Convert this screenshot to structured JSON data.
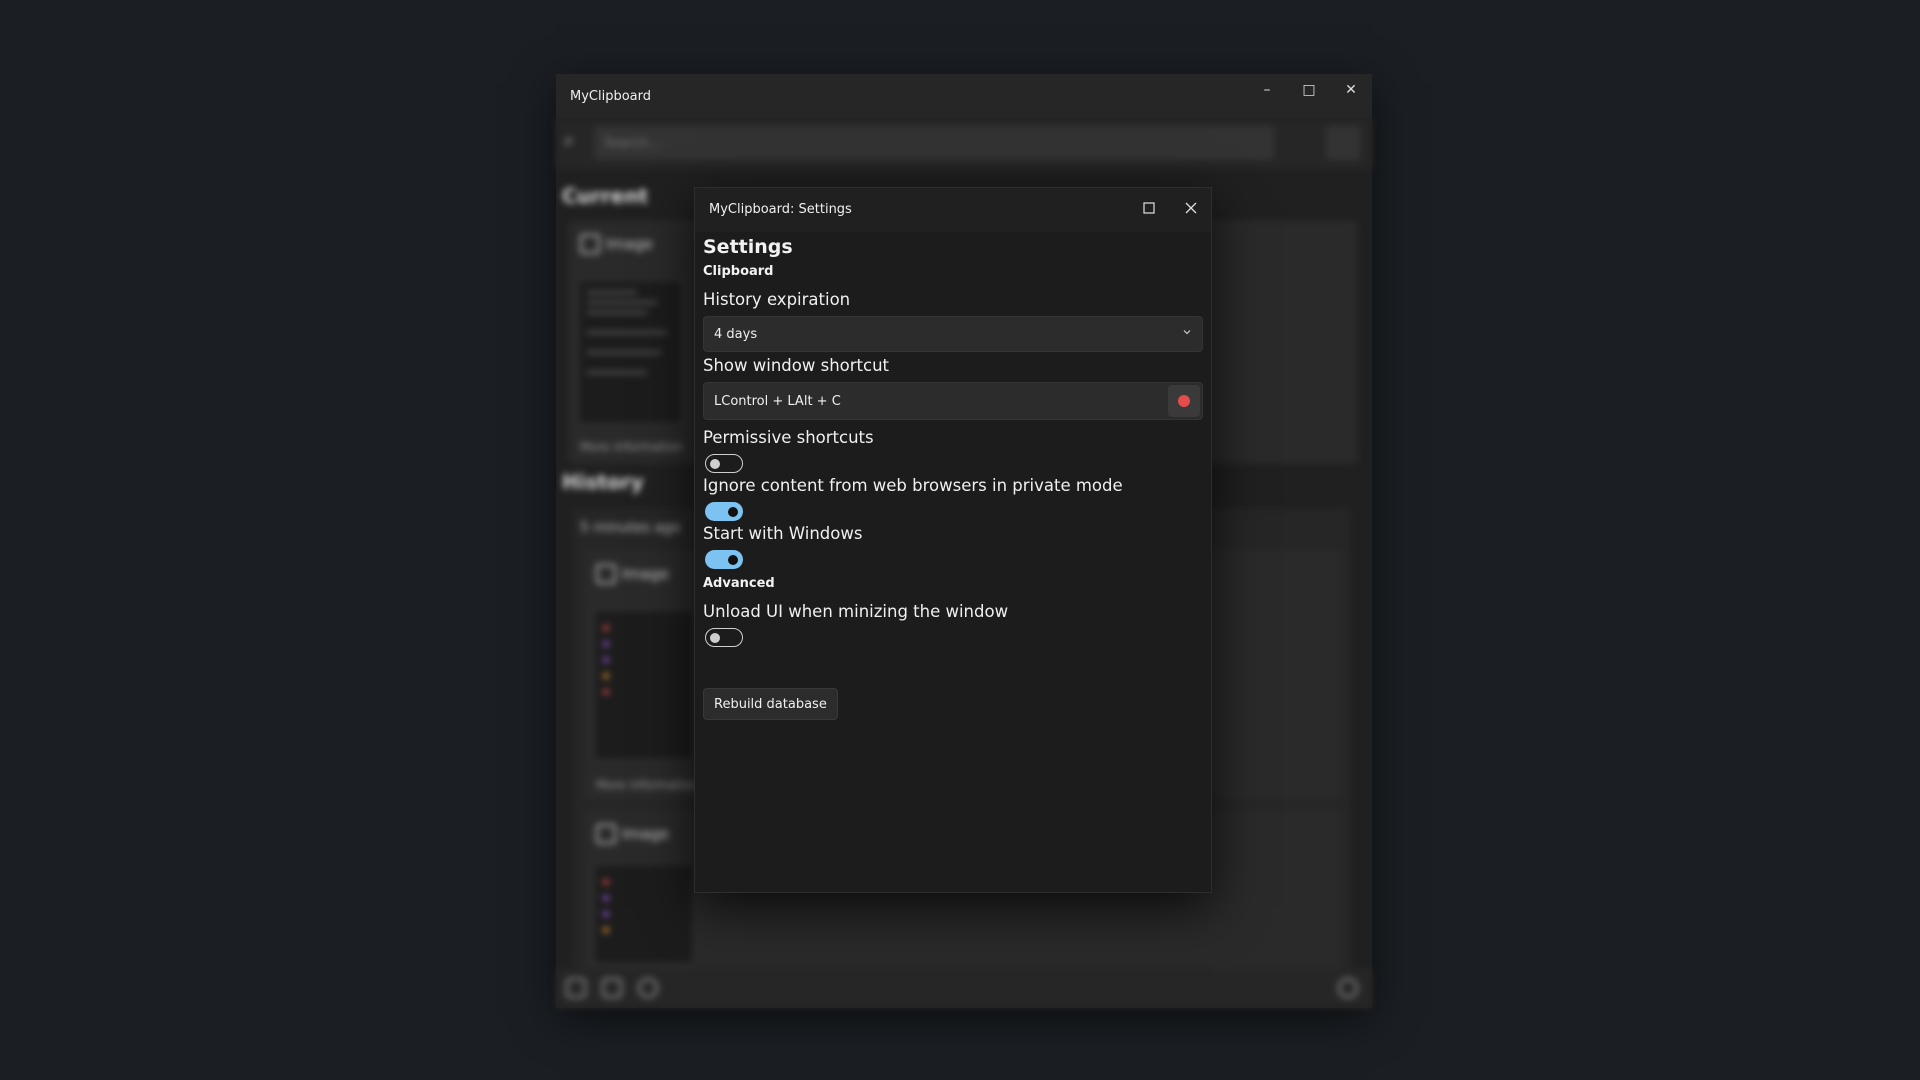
{
  "main_window": {
    "title": "MyClipboard",
    "search_placeholder": "Search...",
    "current_label": "Current",
    "history_label": "History",
    "card_type_label": "Image",
    "more_info_label": "More information",
    "group_time_label": "5 minutes ago"
  },
  "settings_window": {
    "title": "MyClipboard: Settings",
    "heading": "Settings",
    "clipboard_group": "Clipboard",
    "history_expiration": {
      "label": "History expiration",
      "selected": "4 days"
    },
    "show_window_shortcut": {
      "label": "Show window shortcut",
      "value": "LControl + LAlt + C"
    },
    "permissive_shortcuts": {
      "label": "Permissive shortcuts",
      "enabled": false
    },
    "ignore_private": {
      "label": "Ignore content from web browsers in private mode",
      "enabled": true
    },
    "start_with_windows": {
      "label": "Start with Windows",
      "enabled": true
    },
    "advanced_group": "Advanced",
    "unload_ui": {
      "label": "Unload UI when minizing the window",
      "enabled": false
    },
    "rebuild_button": "Rebuild database"
  },
  "colors": {
    "toggle_on": "#7cc3f1",
    "record_dot": "#e44b4b",
    "dialog_bg": "#1c1c1c"
  }
}
